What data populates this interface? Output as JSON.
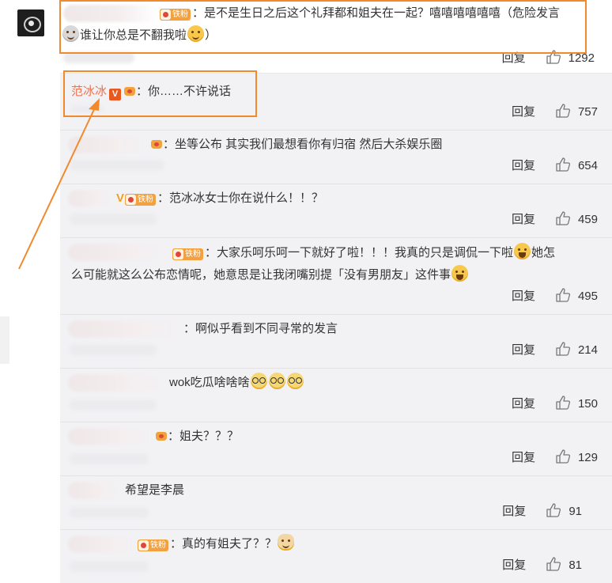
{
  "top_comment": {
    "username": "",
    "fan_badge": "铁粉",
    "text_line1": "：是不是生日之后这个礼拜都和姐夫在一起？嘻嘻嘻嘻嘻嘻（危险发言",
    "text_line2": "谁让你总是不翻我啦",
    "text_line2_end": "）",
    "reply_label": "回复",
    "likes": "1292"
  },
  "replies": [
    {
      "username": "范冰冰",
      "verified": "V",
      "badge": "",
      "text": "：你……不许说话",
      "reply_label": "回复",
      "likes": "757"
    },
    {
      "username": "",
      "badge": "",
      "text": "：坐等公布 其实我们最想看你有归宿 然后大杀娱乐圈",
      "reply_label": "回复",
      "likes": "654"
    },
    {
      "username": "",
      "verified": "V",
      "badge": "铁粉",
      "text": "：范冰冰女士你在说什么！！？",
      "reply_label": "回复",
      "likes": "459"
    },
    {
      "username": "",
      "badge": "铁粉",
      "text_line1": "：大家乐呵乐呵一下就好了啦！！！我真的只是调侃一下啦",
      "text_line1_end": "她怎",
      "text_line2": "么可能就这么公布恋情呢，她意思是让我闭嘴别提「没有男朋友」这件事",
      "reply_label": "回复",
      "likes": "495"
    },
    {
      "username": "",
      "badge": "",
      "text": "：啊似乎看到不同寻常的发言",
      "reply_label": "回复",
      "likes": "214"
    },
    {
      "username": "",
      "badge": "",
      "text": "wok吃瓜啥啥啥",
      "reply_label": "回复",
      "likes": "150"
    },
    {
      "username": "",
      "badge": "",
      "text": "：姐夫？？？",
      "reply_label": "回复",
      "likes": "129"
    },
    {
      "username": "",
      "badge": "",
      "text": "希望是李晨",
      "reply_label": "回复",
      "likes": "91"
    },
    {
      "username": "",
      "badge": "铁粉",
      "text": "：真的有姐夫了？？",
      "reply_label": "回复",
      "likes": "81"
    }
  ],
  "colors": {
    "highlight": "#f08a2c",
    "username": "#eb7350",
    "panel_bg": "#f2f2f5"
  },
  "icons": [
    "like-icon",
    "crown-icon",
    "verified-icon",
    "fan-badge-icon",
    "emoji-icon"
  ]
}
